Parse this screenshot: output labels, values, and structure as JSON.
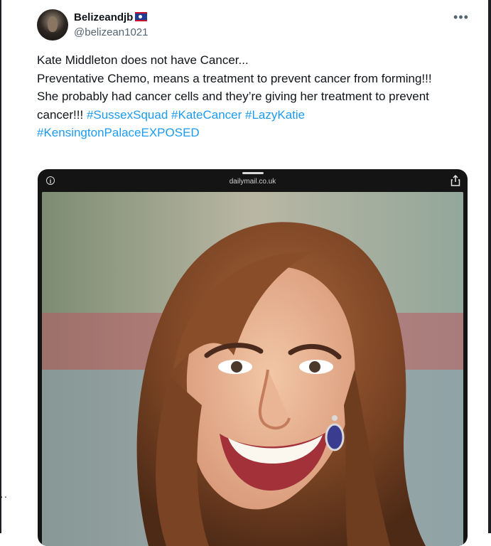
{
  "tweet": {
    "display_name": "Belizeandjb",
    "flag_icon": "belize-flag-icon",
    "handle": "@belizean1021",
    "more_icon": "more-icon",
    "lines": [
      "Kate Middleton does not have Cancer...",
      "Preventative Chemo, means a treatment to prevent cancer from forming!!!",
      "She probably had cancer cells and they’re giving her treatment to prevent cancer!!!"
    ],
    "hashtags": [
      "#SussexSquad",
      "#KateCancer",
      "#LazyKatie",
      "#KensingtonPalaceEXPOSED"
    ]
  },
  "media": {
    "url_label": "dailymail.co.uk",
    "info_icon": "info-icon",
    "share_icon": "share-icon",
    "image_subject": "caricature"
  },
  "colors": {
    "text": "#0f1419",
    "secondary": "#536471",
    "hashtag": "#1d9bf0",
    "media_frame": "#141414"
  }
}
